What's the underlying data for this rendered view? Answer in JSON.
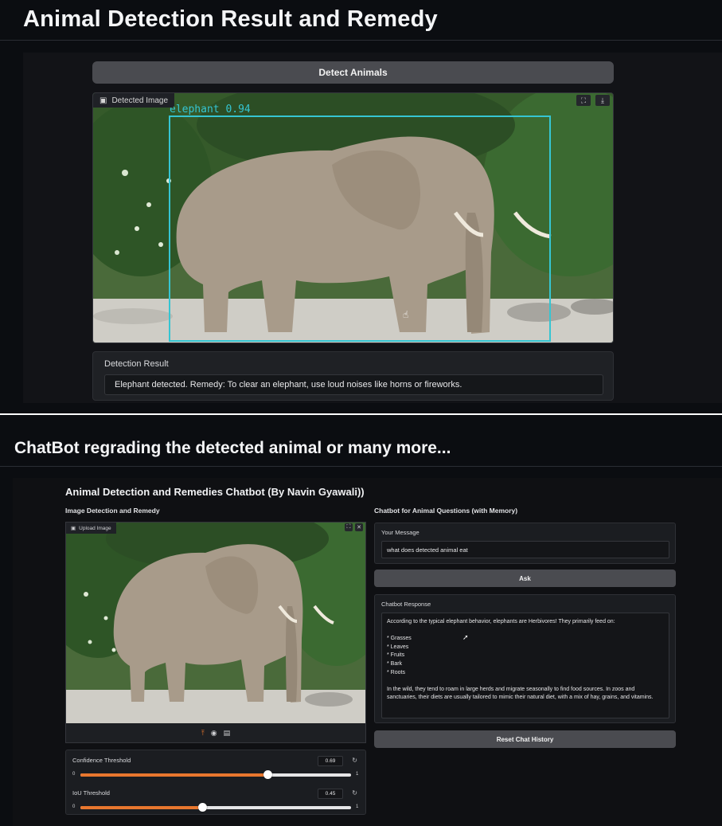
{
  "section1": {
    "title": "Animal Detection Result and Remedy",
    "detect_button": "Detect Animals",
    "image_label": "Detected Image",
    "bbox_label": "elephant 0.94",
    "result_label": "Detection Result",
    "result_text": "Elephant detected. Remedy: To clear an elephant, use loud noises like horns or fireworks."
  },
  "section2": {
    "title": "ChatBot regrading the detected animal or many more...",
    "app_title": "Animal Detection and Remedies Chatbot (By Navin Gyawali))",
    "left_heading": "Image Detection and Remedy",
    "right_heading": "Chatbot for Animal Questions (with Memory)",
    "upload_label": "Upload Image",
    "confidence": {
      "label": "Confidence Threshold",
      "value": "0.69",
      "min": "0",
      "max": "1",
      "fraction": 0.69
    },
    "iou": {
      "label": "IoU Threshold",
      "value": "0.45",
      "min": "0",
      "max": "1",
      "fraction": 0.45
    },
    "message_label": "Your Message",
    "message_value": "what does detected animal eat",
    "ask_button": "Ask",
    "response_label": "Chatbot Response",
    "response_intro": "According to the typical elephant behavior, elephants are Herbivores! They primarily feed on:",
    "response_items": [
      "* Grasses",
      "* Leaves",
      "* Fruits",
      "* Bark",
      "* Roots"
    ],
    "response_outro": "In the wild, they tend to roam in large herds and migrate seasonally to find food sources. In zoos and sanctuaries, their diets are usually tailored to mimic their natural diet, with a mix of hay, grains, and vitamins.",
    "reset_button": "Reset Chat History"
  },
  "icons": {
    "image": "image-icon",
    "fullscreen": "fullscreen-icon",
    "download": "download-icon",
    "close": "close-icon",
    "upload": "upload-icon",
    "webcam": "webcam-icon",
    "clipboard": "clipboard-icon",
    "reset": "reset-icon"
  },
  "colors": {
    "accent": "#e8772e",
    "bbox": "#35c5d2"
  }
}
